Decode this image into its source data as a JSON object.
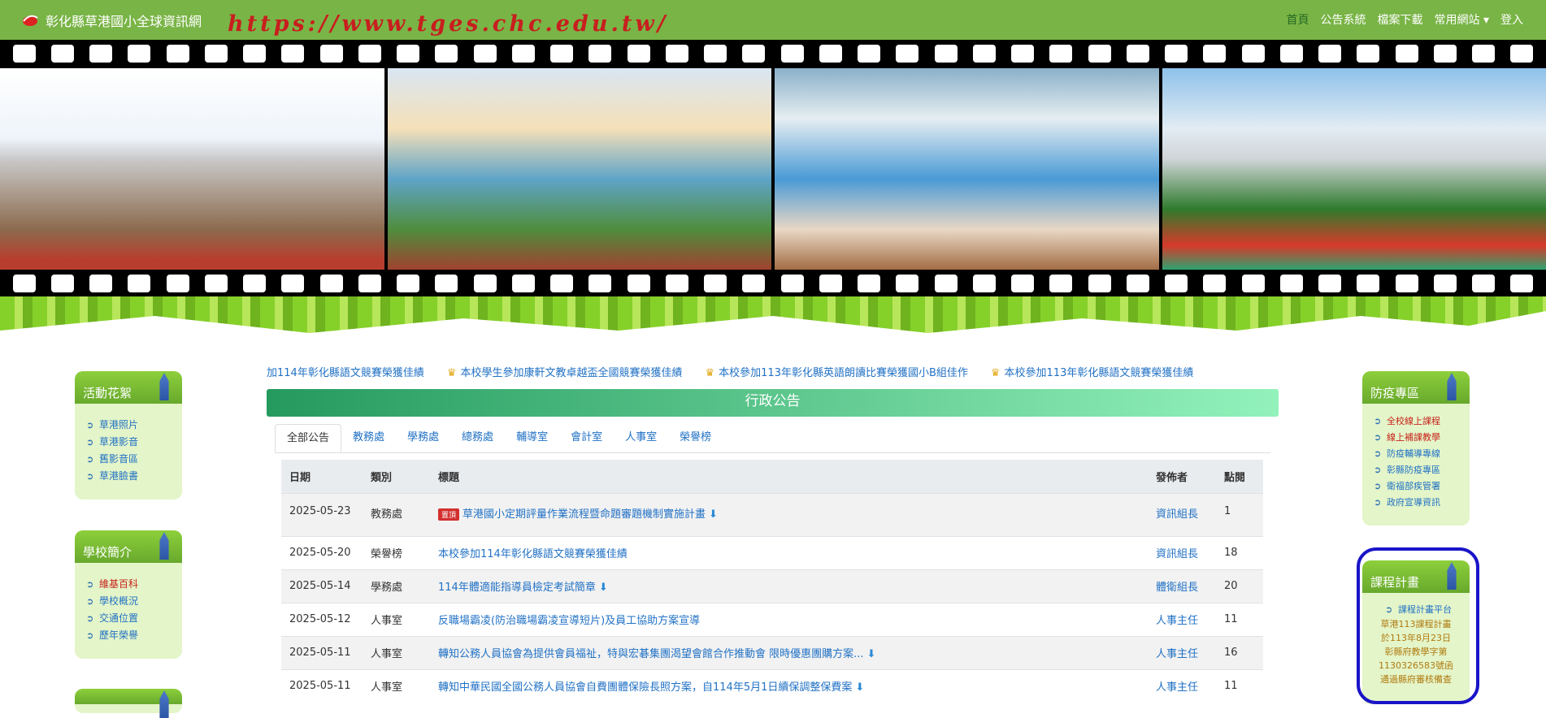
{
  "header": {
    "site_name": "彰化縣草港國小全球資訊網",
    "url_text": "https://www.tges.chc.edu.tw/",
    "nav": [
      "首頁",
      "公告系統",
      "檔案下載",
      "常用網站 ▾",
      "登入"
    ]
  },
  "left_sidebar": [
    {
      "title": "活動花絮",
      "items": [
        "草港照片",
        "草港影音",
        "舊影音區",
        "草港臉書"
      ]
    },
    {
      "title": "學校簡介",
      "items": [
        "維基百科",
        "學校概況",
        "交通位置",
        "歷年榮譽"
      ]
    }
  ],
  "right_sidebar": [
    {
      "title": "防疫專區",
      "items": [
        "全校線上課程",
        "線上補課教學",
        "防疫輔導專線",
        "彰縣防疫專區",
        "衛福部疾管署",
        "政府宣導資訊"
      ]
    },
    {
      "title": "課程計畫",
      "items": [
        "課程計畫平台"
      ],
      "notes": [
        "草港113課程計畫",
        "於113年8月23日",
        "彰縣府教學字第",
        "1130326583號函",
        "通過縣府審核備查"
      ]
    }
  ],
  "marquee": [
    "加114年彰化縣語文競賽榮獲佳績",
    "本校學生參加康軒文教卓越盃全國競賽榮獲佳績",
    "本校參加113年彰化縣英語朗讀比賽榮獲國小B組佳作",
    "本校參加113年彰化縣語文競賽榮獲佳績"
  ],
  "announcements": {
    "title": "行政公告",
    "tabs": [
      "全部公告",
      "教務處",
      "學務處",
      "總務處",
      "輔導室",
      "會計室",
      "人事室",
      "榮譽榜"
    ],
    "columns": [
      "日期",
      "類別",
      "標題",
      "發佈者",
      "點閱"
    ],
    "rows": [
      {
        "date": "2025-05-23",
        "category": "教務處",
        "badge": "置頂",
        "title": "草港國小定期評量作業流程暨命題審題機制實施計畫",
        "download": true,
        "publisher": "資訊組長",
        "views": "1"
      },
      {
        "date": "2025-05-20",
        "category": "榮譽榜",
        "badge": "",
        "title": "本校參加114年彰化縣語文競賽榮獲佳績",
        "download": false,
        "publisher": "資訊組長",
        "views": "18"
      },
      {
        "date": "2025-05-14",
        "category": "學務處",
        "badge": "",
        "title": "114年體適能指導員檢定考試簡章",
        "download": true,
        "publisher": "體衛組長",
        "views": "20"
      },
      {
        "date": "2025-05-12",
        "category": "人事室",
        "badge": "",
        "title": "反職場霸凌(防治職場霸凌宣導短片)及員工協助方案宣導",
        "download": false,
        "publisher": "人事主任",
        "views": "11"
      },
      {
        "date": "2025-05-11",
        "category": "人事室",
        "badge": "",
        "title": "轉知公務人員協會為提供會員福祉，特與宏碁集團渴望會館合作推動會 限時優惠團購方案...",
        "download": true,
        "publisher": "人事主任",
        "views": "16"
      },
      {
        "date": "2025-05-11",
        "category": "人事室",
        "badge": "",
        "title": "轉知中華民國全國公務人員協會自費團體保險長照方案，自114年5月1日續保調整保費案",
        "download": true,
        "publisher": "人事主任",
        "views": "11"
      }
    ]
  }
}
